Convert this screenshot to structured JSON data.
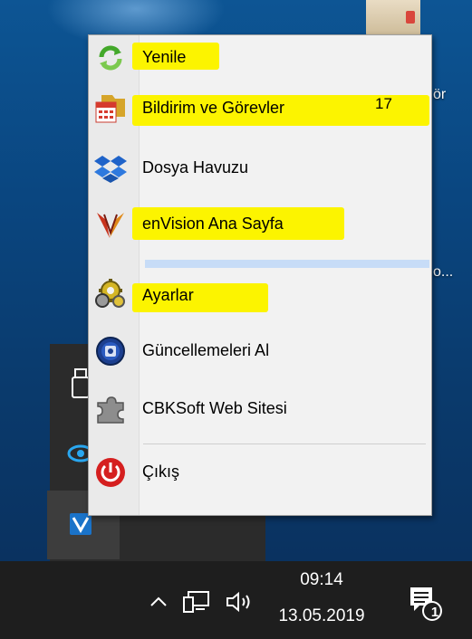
{
  "desktop": {
    "fragment_top": "ör",
    "fragment_mid": "o..."
  },
  "context_menu": {
    "items": [
      {
        "label": "Yenile",
        "icon": "refresh-icon"
      },
      {
        "label": "Bildirim ve Görevler",
        "icon": "calendar-folder-icon",
        "badge": "17"
      },
      {
        "label": "Dosya Havuzu",
        "icon": "dropbox-box-icon"
      },
      {
        "label": "enVision Ana Sayfa",
        "icon": "envision-logo-icon"
      },
      {
        "label": "Ayarlar",
        "icon": "settings-gear-icon"
      },
      {
        "label": "Güncellemeleri Al",
        "icon": "update-disc-icon"
      },
      {
        "label": "CBKSoft Web Sitesi",
        "icon": "puzzle-piece-icon"
      },
      {
        "label": "Çıkış",
        "icon": "power-icon"
      }
    ]
  },
  "taskbar": {
    "time": "09:14",
    "date": "13.05.2019",
    "notification_count": "1"
  },
  "colors": {
    "highlight": "#fcf400",
    "menu_background": "#f2f2f2",
    "taskbar": "#1e1e1e"
  }
}
